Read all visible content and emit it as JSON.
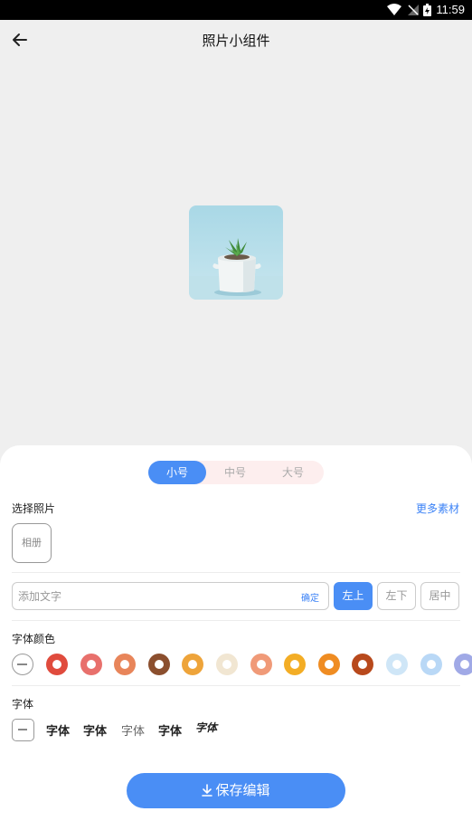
{
  "status_bar": {
    "time": "11:59"
  },
  "header": {
    "title": "照片小组件"
  },
  "size_tabs": [
    {
      "label": "小号",
      "active": true
    },
    {
      "label": "中号",
      "active": false
    },
    {
      "label": "大号",
      "active": false
    }
  ],
  "photo_section": {
    "label": "选择照片",
    "more_label": "更多素材",
    "album_label": "相册"
  },
  "text_section": {
    "placeholder": "添加文字",
    "value": "",
    "confirm_label": "确定",
    "positions": [
      {
        "label": "左上",
        "active": true
      },
      {
        "label": "左下",
        "active": false
      },
      {
        "label": "居中",
        "active": false
      }
    ]
  },
  "color_section": {
    "label": "字体颜色",
    "swatches": [
      "#e04b3d",
      "#e8706c",
      "#e8855a",
      "#8b4f2e",
      "#eea43a",
      "#f1e6d2",
      "#f09a78",
      "#f3ad25",
      "#ef8c22",
      "#b8491c",
      "#cfe6f7",
      "#b9d8f6",
      "#a0a9e6"
    ]
  },
  "font_section": {
    "label": "字体",
    "options": [
      "字体",
      "字体",
      "字体",
      "字体",
      "字体"
    ]
  },
  "save_button": {
    "label": "保存编辑"
  },
  "accent_color": "#4a8ef5"
}
